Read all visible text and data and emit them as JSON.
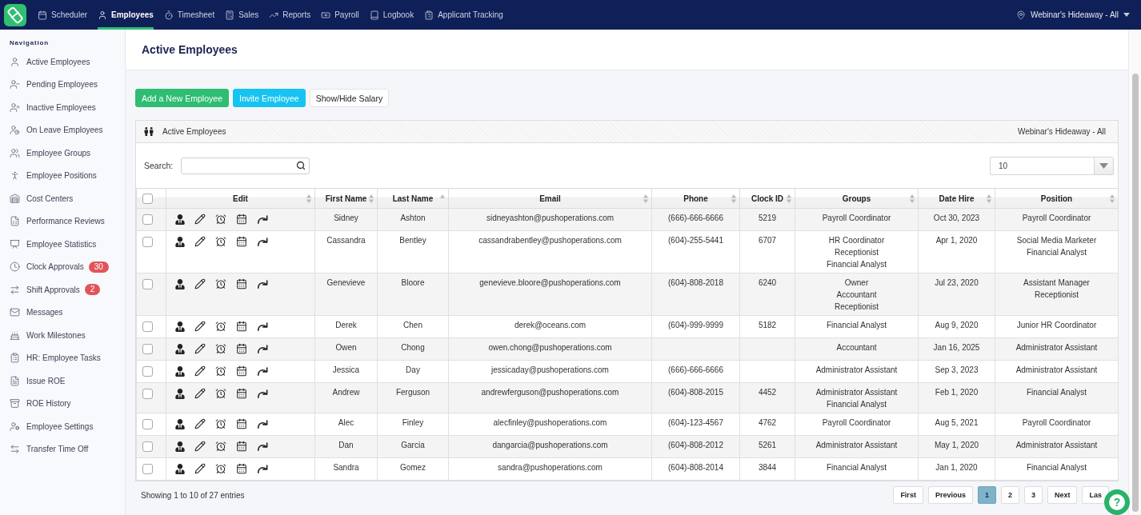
{
  "top_nav": {
    "items": [
      {
        "label": "Scheduler",
        "selected": false
      },
      {
        "label": "Employees",
        "selected": true
      },
      {
        "label": "Timesheet",
        "selected": false
      },
      {
        "label": "Sales",
        "selected": false
      },
      {
        "label": "Reports",
        "selected": false
      },
      {
        "label": "Payroll",
        "selected": false
      },
      {
        "label": "Logbook",
        "selected": false
      },
      {
        "label": "Applicant Tracking",
        "selected": false
      }
    ],
    "location": "Webinar's Hideaway - All"
  },
  "sidebar": {
    "heading": "Navigation",
    "items": [
      {
        "label": "Active Employees",
        "selected": false
      },
      {
        "label": "Pending Employees",
        "selected": false
      },
      {
        "label": "Inactive Employees",
        "selected": false
      },
      {
        "label": "On Leave Employees",
        "selected": false
      },
      {
        "label": "Employee Groups",
        "selected": false
      },
      {
        "label": "Employee Positions",
        "selected": false
      },
      {
        "label": "Cost Centers",
        "selected": false
      },
      {
        "label": "Performance Reviews",
        "selected": false
      },
      {
        "label": "Employee Statistics",
        "selected": false
      },
      {
        "label": "Clock Approvals",
        "selected": false,
        "badge": "30"
      },
      {
        "label": "Shift Approvals",
        "selected": false,
        "badge": "2"
      },
      {
        "label": "Messages",
        "selected": false
      },
      {
        "label": "Work Milestones",
        "selected": false
      },
      {
        "label": "HR: Employee Tasks",
        "selected": false
      },
      {
        "label": "Issue ROE",
        "selected": false
      },
      {
        "label": "ROE History",
        "selected": false
      },
      {
        "label": "Employee Settings",
        "selected": false
      },
      {
        "label": "Transfer Time Off",
        "selected": false
      }
    ]
  },
  "page": {
    "title": "Active Employees",
    "buttons": [
      {
        "label": "Add a New Employee",
        "kind": "success"
      },
      {
        "label": "Invite Employee",
        "kind": "info"
      },
      {
        "label": "Show/Hide Salary",
        "kind": "default"
      }
    ]
  },
  "panel": {
    "title": "Active Employees",
    "location": "Webinar's Hideaway - All",
    "search": {
      "label": "Search:"
    },
    "page_size": "10",
    "table": {
      "columns": [
        {
          "kind": "checkbox",
          "checked": false
        },
        {
          "kind": "text",
          "label": "Edit",
          "sorted": false
        },
        {
          "kind": "text",
          "label": "First Name",
          "sorted": false
        },
        {
          "kind": "text",
          "label": "Last Name",
          "sorted": true
        },
        {
          "kind": "text",
          "label": "Email",
          "sorted": false
        },
        {
          "kind": "text",
          "label": "Phone",
          "sorted": false
        },
        {
          "kind": "text",
          "label": "Clock ID",
          "sorted": false
        },
        {
          "kind": "text",
          "label": "Groups",
          "sorted": false
        },
        {
          "kind": "text",
          "label": "Date Hire",
          "sorted": false
        },
        {
          "kind": "text",
          "label": "Position",
          "sorted": false
        }
      ],
      "rows": [
        {
          "checked": false,
          "first_name": "Sidney",
          "last_name": "Ashton",
          "email": "sidneyashton@pushoperations.com",
          "phone": "(666)-666-6666",
          "clock_id": "5219",
          "groups": [
            "Payroll Coordinator"
          ],
          "date_hire": "Oct 30, 2023",
          "position": [
            "Payroll Coordinator"
          ]
        },
        {
          "checked": false,
          "first_name": "Cassandra",
          "last_name": "Bentley",
          "email": "cassandrabentley@pushoperations.com",
          "phone": "(604)-255-5441",
          "clock_id": "6707",
          "groups": [
            "HR Coordinator",
            "Receptionist",
            "Financial Analyst"
          ],
          "date_hire": "Apr 1, 2020",
          "position": [
            "Social Media Marketer",
            "Financial Analyst"
          ]
        },
        {
          "checked": false,
          "first_name": "Genevieve",
          "last_name": "Bloore",
          "email": "genevieve.bloore@pushoperations.com",
          "phone": "(604)-808-2018",
          "clock_id": "6240",
          "groups": [
            "Owner",
            "Accountant",
            "Receptionist"
          ],
          "date_hire": "Jul 23, 2020",
          "position": [
            "Assistant Manager",
            "Receptionist"
          ]
        },
        {
          "checked": false,
          "first_name": "Derek",
          "last_name": "Chen",
          "email": "derek@oceans.com",
          "phone": "(604)-999-9999",
          "clock_id": "5182",
          "groups": [
            "Financial Analyst"
          ],
          "date_hire": "Aug 9, 2020",
          "position": [
            "Junior HR Coordinator"
          ]
        },
        {
          "checked": false,
          "first_name": "Owen",
          "last_name": "Chong",
          "email": "owen.chong@pushoperations.com",
          "groups": [
            "Accountant"
          ],
          "date_hire": "Jan 16, 2025",
          "position": [
            "Administrator Assistant"
          ]
        },
        {
          "checked": false,
          "first_name": "Jessica",
          "last_name": "Day",
          "email": "jessicaday@pushoperations.com",
          "phone": "(666)-666-6666",
          "groups": [
            "Administrator Assistant"
          ],
          "date_hire": "Sep 3, 2023",
          "position": [
            "Administrator Assistant"
          ]
        },
        {
          "checked": false,
          "first_name": "Andrew",
          "last_name": "Ferguson",
          "email": "andrewferguson@pushoperations.com",
          "phone": "(604)-808-2015",
          "clock_id": "4452",
          "groups": [
            "Administrator Assistant",
            "Financial Analyst"
          ],
          "date_hire": "Feb 1, 2020",
          "position": [
            "Financial Analyst"
          ]
        },
        {
          "checked": false,
          "first_name": "Alec",
          "last_name": "Finley",
          "email": "alecfinley@pushoperations.com",
          "phone": "(604)-123-4567",
          "clock_id": "4762",
          "groups": [
            "Payroll Coordinator"
          ],
          "date_hire": "Aug 5, 2021",
          "position": [
            "Payroll Coordinator"
          ]
        },
        {
          "checked": false,
          "first_name": "Dan",
          "last_name": "Garcia",
          "email": "dangarcia@pushoperations.com",
          "phone": "(604)-808-2012",
          "clock_id": "5261",
          "groups": [
            "Administrator Assistant"
          ],
          "date_hire": "May 1, 2020",
          "position": [
            "Administrator Assistant"
          ]
        },
        {
          "checked": false,
          "first_name": "Sandra",
          "last_name": "Gomez",
          "email": "sandra@pushoperations.com",
          "phone": "(604)-808-2014",
          "clock_id": "3844",
          "groups": [
            "Financial Analyst"
          ],
          "date_hire": "Jan 1, 2020",
          "position": [
            "Financial Analyst"
          ]
        }
      ]
    }
  },
  "footer": {
    "info": "Showing 1 to 10 of 27 entries",
    "pages": [
      {
        "label": "First",
        "selected": false
      },
      {
        "label": "Previous",
        "selected": false
      },
      {
        "label": "1",
        "selected": true
      },
      {
        "label": "2",
        "selected": false
      },
      {
        "label": "3",
        "selected": false
      },
      {
        "label": "Next",
        "selected": false
      },
      {
        "label": "Las",
        "selected": false
      }
    ]
  },
  "help_button": {
    "label": "?"
  }
}
